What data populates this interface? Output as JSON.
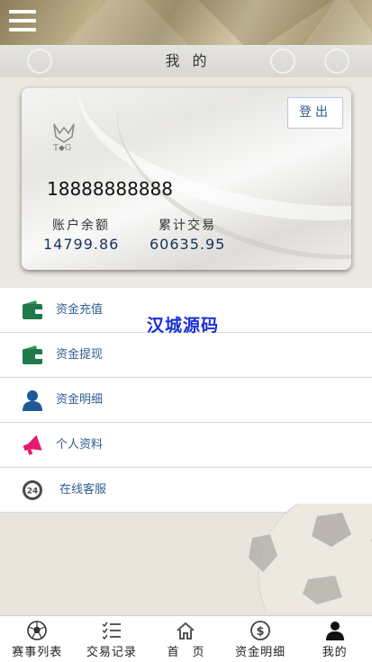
{
  "header": {
    "menu_icon": "hamburger-icon",
    "title": "我的"
  },
  "account": {
    "logout_label": "登出",
    "logo_text": "T◆G",
    "phone": "18888888888",
    "balance_label": "账户余额",
    "balance_value": "14799.86",
    "total_trade_label": "累计交易",
    "total_trade_value": "60635.95"
  },
  "menu": [
    {
      "label": "资金充值",
      "icon": "wallet-icon",
      "color": "#1f7a4a"
    },
    {
      "label": "资金提现",
      "icon": "wallet-icon",
      "color": "#1f7a4a"
    },
    {
      "label": "资金明细",
      "icon": "user-icon",
      "color": "#1e5a9a"
    },
    {
      "label": "个人资料",
      "icon": "megaphone-icon",
      "color": "#e6196c"
    },
    {
      "label": "在线客服",
      "icon": "24h-clock-icon",
      "color": "#4a4a4a"
    }
  ],
  "watermark": "汉城源码",
  "bottom_nav": [
    {
      "label": "赛事列表",
      "icon": "soccer-ball-icon"
    },
    {
      "label": "交易记录",
      "icon": "checklist-icon"
    },
    {
      "label": "首　页",
      "icon": "home-icon"
    },
    {
      "label": "资金明细",
      "icon": "dollar-circle-icon"
    },
    {
      "label": "我的",
      "icon": "person-icon"
    }
  ]
}
